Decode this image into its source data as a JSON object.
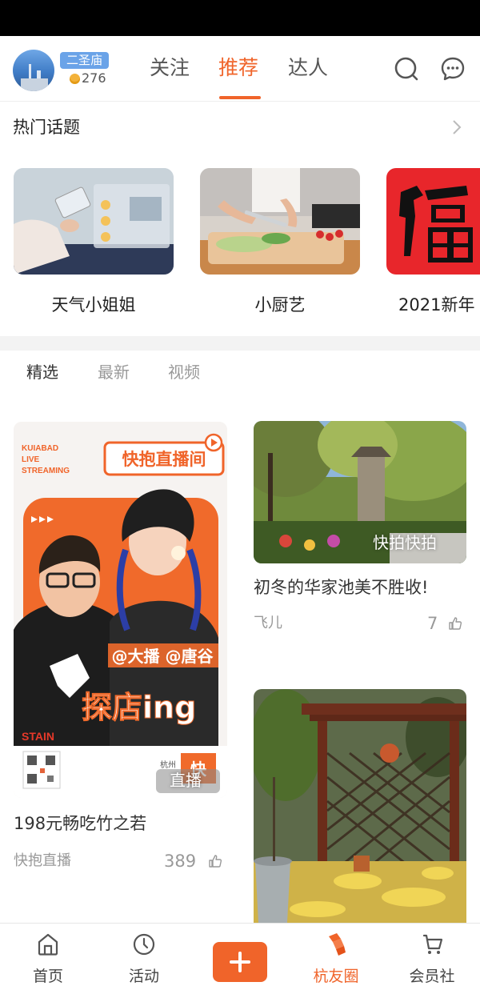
{
  "header": {
    "location": "二圣庙",
    "coins": "276",
    "tabs": [
      {
        "label": "关注",
        "active": false
      },
      {
        "label": "推荐",
        "active": true
      },
      {
        "label": "达人",
        "active": false
      }
    ],
    "icons": [
      "search-icon",
      "message-icon"
    ]
  },
  "hot_topics": {
    "title": "热门话题",
    "items": [
      {
        "label": "天气小姐姐"
      },
      {
        "label": "小厨艺"
      },
      {
        "label": "2021新年"
      }
    ]
  },
  "sub_tabs": [
    {
      "label": "精选",
      "active": true
    },
    {
      "label": "最新",
      "active": false
    },
    {
      "label": "视频",
      "active": false
    }
  ],
  "feed": {
    "left": {
      "poster": {
        "tag_en": "KUIABAD LIVE STREAMING",
        "tag_en_lines": [
          "KUIABAD",
          "LIVE",
          "STREAMING"
        ],
        "banner": "快抱直播间",
        "hosts": "@大播 @唐谷",
        "slogan": "探店ing",
        "stain": "STAIN",
        "city": "杭州",
        "brand_char": "快"
      },
      "overlay": "直播",
      "title": "198元畅吃竹之若",
      "author": "快抱直播",
      "likes": "389"
    },
    "right_top": {
      "overlay": "快拍快拍",
      "title": "初冬的华家池美不胜收!",
      "author": "飞儿",
      "likes": "7"
    },
    "right_bottom": {}
  },
  "bottom_nav": [
    {
      "label": "首页",
      "icon": "home-icon",
      "active": false
    },
    {
      "label": "活动",
      "icon": "clock-icon",
      "active": false
    },
    {
      "label": "",
      "icon": "plus-icon",
      "active": false
    },
    {
      "label": "杭友圈",
      "icon": "friends-circle-icon",
      "active": true
    },
    {
      "label": "会员社",
      "icon": "cart-icon",
      "active": false
    }
  ],
  "colors": {
    "accent": "#f0642a",
    "badge": "#6aa3e8",
    "coin": "#f3b23a"
  }
}
